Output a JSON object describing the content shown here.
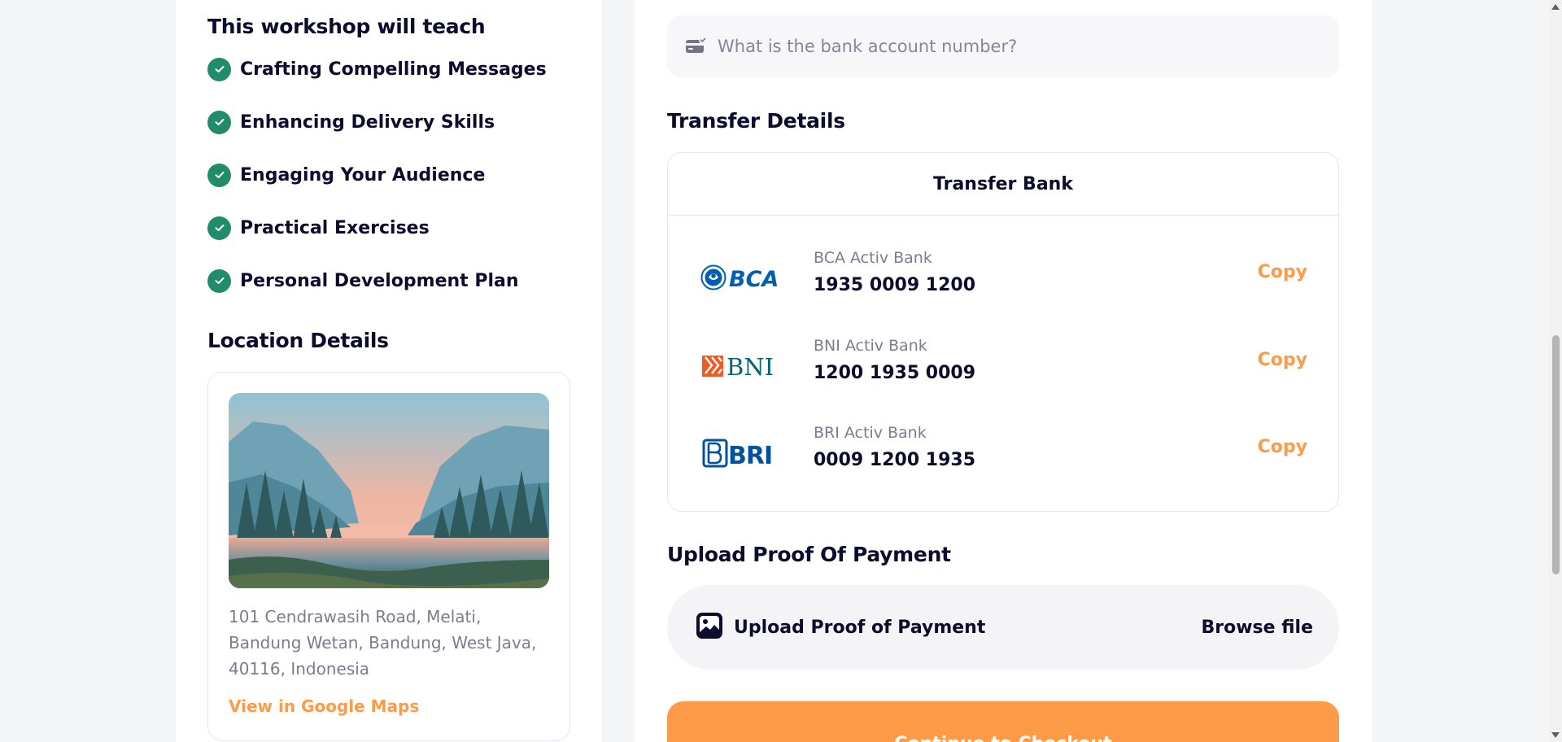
{
  "workshop": {
    "teach_title": "This workshop will teach",
    "benefits": [
      "Crafting Compelling Messages",
      "Enhancing Delivery Skills",
      "Engaging Your Audience",
      "Practical Exercises",
      "Personal Development Plan"
    ]
  },
  "location": {
    "title": "Location Details",
    "address": "101 Cendrawasih Road, Melati, Bandung Wetan, Bandung, West Java, 40116, Indonesia",
    "maps_link": "View in Google Maps"
  },
  "account_input": {
    "placeholder": "What is the bank account number?",
    "value": ""
  },
  "transfer": {
    "title": "Transfer Details",
    "box_title": "Transfer Bank",
    "copy_label": "Copy",
    "banks": [
      {
        "logo_text": "BCA",
        "name": "BCA Activ Bank",
        "number": "1935 0009 1200"
      },
      {
        "logo_text": "BNI",
        "name": "BNI Activ Bank",
        "number": "1200 1935 0009"
      },
      {
        "logo_text": "BRI",
        "name": "BRI Activ Bank",
        "number": "0009 1200 1935"
      }
    ]
  },
  "upload": {
    "title": "Upload Proof Of Payment",
    "label": "Upload Proof of Payment",
    "browse_label": "Browse file"
  },
  "checkout": {
    "label": "Continue to Checkout"
  },
  "colors": {
    "accent": "#fe9b48",
    "check": "#218c6a",
    "heading": "#0c0c2d",
    "muted": "#7a7c90",
    "bca": "#0060af",
    "bni_orange": "#f15a23",
    "bni_teal": "#006770",
    "bri": "#00529c"
  },
  "scroll": {
    "position_fraction": 0.46
  }
}
